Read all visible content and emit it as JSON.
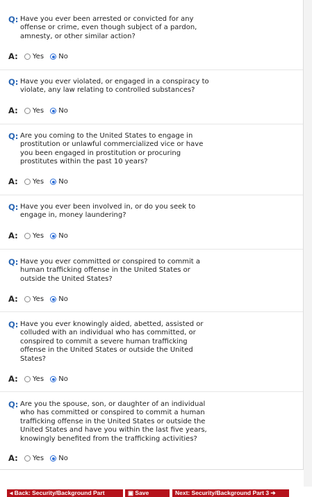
{
  "question_letter": "Q:",
  "answer_letter": "A:",
  "option_yes": "Yes",
  "option_no": "No",
  "questions": [
    {
      "text": "Have you ever been arrested or convicted for any offense or crime, even though subject of a pardon, amnesty, or other similar action?",
      "selected": "No"
    },
    {
      "text": "Have you ever violated, or engaged in a conspiracy to violate, any law relating to controlled substances?",
      "selected": "No"
    },
    {
      "text": "Are you coming to the United States to engage in prostitution or unlawful commercialized vice or have you been engaged in prostitution or procuring prostitutes within the past 10 years?",
      "selected": "No"
    },
    {
      "text": "Have you ever been involved in, or do you seek to engage in, money laundering?",
      "selected": "No"
    },
    {
      "text": "Have you ever committed or conspired to commit a human trafficking offense in the United States or outside the United States?",
      "selected": "No"
    },
    {
      "text": "Have you ever knowingly aided, abetted, assisted or colluded with an individual who has committed, or conspired to commit a severe human trafficking offense in the United States or outside the United States?",
      "selected": "No"
    },
    {
      "text": "Are you the spouse, son, or daughter of an individual who has committed or conspired to commit a human trafficking offense in the United States or outside the United States and have you within the last five years, knowingly benefited from the trafficking activities?",
      "selected": "No"
    }
  ],
  "nav": {
    "back_label": "◂ Back: Security/Background Part",
    "save_label": "Save",
    "next_label": "Next: Security/Background Part 3 ➔"
  }
}
